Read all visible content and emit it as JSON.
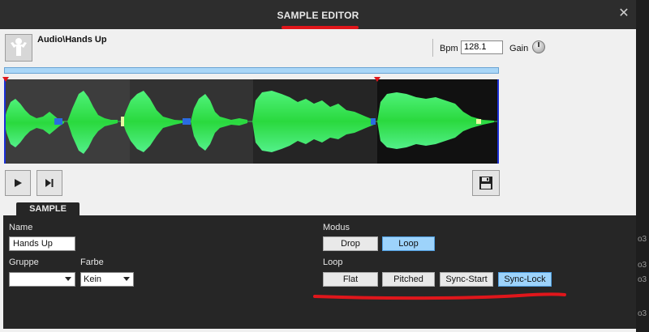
{
  "window": {
    "title": "SAMPLE EDITOR",
    "close_glyph": "✕"
  },
  "header": {
    "track_name": "Audio\\Hands Up",
    "bpm_label": "Bpm",
    "bpm_value": "128.1",
    "gain_label": "Gain"
  },
  "transport": {
    "play_icon": "play-icon",
    "skip_icon": "skip-to-end-icon",
    "save_icon": "floppy-disk-icon"
  },
  "panel": {
    "tab_label": "SAMPLE",
    "name_label": "Name",
    "name_value": "Hands Up",
    "group_label": "Gruppe",
    "group_value": "",
    "color_label": "Farbe",
    "color_value": "Kein",
    "mode_label": "Modus",
    "mode_buttons": [
      {
        "label": "Drop",
        "active": false
      },
      {
        "label": "Loop",
        "active": true
      }
    ],
    "loop_label": "Loop",
    "loop_buttons": [
      {
        "label": "Flat",
        "active": false
      },
      {
        "label": "Pitched",
        "active": false
      },
      {
        "label": "Sync-Start",
        "active": false
      },
      {
        "label": "Sync-Lock",
        "active": true
      }
    ]
  },
  "colors": {
    "annotation": "#e0161b",
    "active_button": "#9dd3fb",
    "waveform": "#3cf04a"
  }
}
